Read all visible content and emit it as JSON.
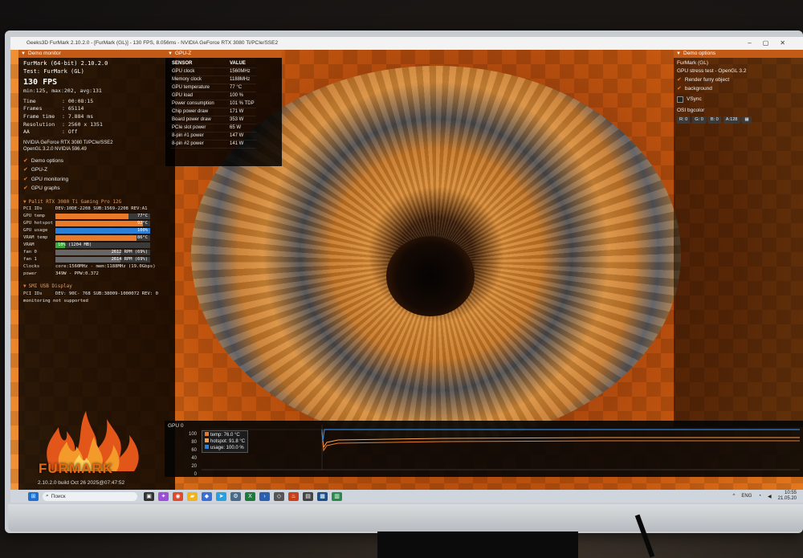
{
  "window": {
    "title": "Geeks3D FurMark 2.10.2.0 - [FurMark (GL)] - 130 FPS, 8.056ms - NVIDIA GeForce RTX 3080 Ti/PCIe/SSE2"
  },
  "demo_monitor": {
    "header": "Demo monitor",
    "title_line1": "FurMark (64-bit) 2.10.2.0",
    "title_line2": "Test: FurMark (GL)",
    "fps": "130 FPS",
    "minmax": "min:125, max:202, avg:131",
    "stats": [
      {
        "k": "Time",
        "v": ": 00:08:15"
      },
      {
        "k": "Frames",
        "v": ": 65114"
      },
      {
        "k": "Frame time",
        "v": ": 7.884 ms"
      },
      {
        "k": "Resolution",
        "v": ": 2560 x 1351"
      },
      {
        "k": "AA",
        "v": ": Off"
      }
    ],
    "gpu_name": "NVIDIA GeForce RTX 3080 Ti/PCIe/SSE2",
    "gl_version": "OpenGL 3.2.0 NVIDIA 596.49",
    "options": [
      "Demo options",
      "GPU-Z",
      "GPU monitoring",
      "GPU graphs"
    ],
    "card_header": "Palit RTX 3080 Ti Gaming Pro 12G",
    "pci_ids": "DEV:10DE-2208 SUB:1569-2208 REV:A1",
    "sensors": [
      {
        "k": "GPU temp",
        "v": "77°C",
        "fraction": 0.77,
        "color": "#e87a2a"
      },
      {
        "k": "GPU hotspot",
        "v": "92°C",
        "fraction": 0.92,
        "color": "#e87a2a"
      },
      {
        "k": "GPU usage",
        "v": "100%",
        "fraction": 1.0,
        "color": "#2b7fd6"
      },
      {
        "k": "VRAM temp",
        "v": "86°C",
        "fraction": 0.86,
        "color": "#e87a2a"
      },
      {
        "k": "VRAM",
        "v": "10% (1204 MB)",
        "fraction": 0.1,
        "color": "#3aa83a"
      },
      {
        "k": "fan 0",
        "v": "2612 RPM (69%)",
        "fraction": 0.69,
        "color": "#666"
      },
      {
        "k": "fan 1",
        "v": "2614 RPM (69%)",
        "fraction": 0.69,
        "color": "#666"
      }
    ],
    "clocks_label": "Clocks",
    "clocks_value": "core:1560MHz - mem:1188MHz (19.0Gbps)",
    "power_label": "power",
    "power_value": "349W - PPW:0.372",
    "smi_header": "SMI USB Display",
    "smi_pci_label": "PCI IDs",
    "smi_pci_value": "DEV: 90C- 768 SUB:38009-1000072 REV: 0",
    "smi_note": "monitoring not supported",
    "logo_text": "FURMARK",
    "build": "2.10.2.0 build Oct 26 2025@07:47:52"
  },
  "gpuz": {
    "header": "GPU-Z",
    "col_sensor": "SENSOR",
    "col_value": "VALUE",
    "rows": [
      {
        "sensor": "GPU clock",
        "value": "1560MHz"
      },
      {
        "sensor": "Memory clock",
        "value": "1188MHz"
      },
      {
        "sensor": "GPU temperature",
        "value": "77 °C"
      },
      {
        "sensor": "GPU load",
        "value": "100 %"
      },
      {
        "sensor": "Power consumption",
        "value": "101 % TDP"
      },
      {
        "sensor": "Chip power draw",
        "value": "171 W"
      },
      {
        "sensor": "Board power draw",
        "value": "353 W"
      },
      {
        "sensor": "PCIe slot power",
        "value": "65 W"
      },
      {
        "sensor": "8-pin #1 power",
        "value": "147 W"
      },
      {
        "sensor": "8-pin #2 power",
        "value": "141 W"
      }
    ]
  },
  "demo_options": {
    "header": "Demo options",
    "mode": "FurMark (GL)",
    "desc": "GPU stress test - OpenGL 3.2",
    "render_furry": "Render furry object",
    "background": "background",
    "vsync": "VSync",
    "osi_label": "OSI bgcolor",
    "rgba": [
      "R: 0",
      "G: 0",
      "B: 0",
      "A:128"
    ]
  },
  "graph": {
    "label": "GPU 0",
    "yticks": [
      "100",
      "80",
      "60",
      "40",
      "20",
      "0"
    ],
    "legend": [
      {
        "text": "temp: 76.0 °C",
        "color": "#e87a2a"
      },
      {
        "text": "hotspot: 91.8 °C",
        "color": "#f0a050"
      },
      {
        "text": "usage: 100.0 %",
        "color": "#2b7fd6"
      }
    ]
  },
  "taskbar": {
    "search_placeholder": "Поиск",
    "lang": "ENG",
    "time": "10:55",
    "date": "21.05.20"
  }
}
